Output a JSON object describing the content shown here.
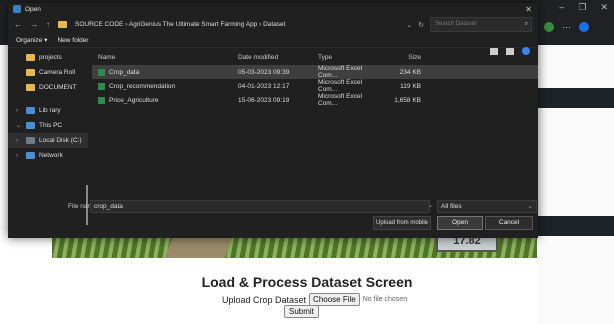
{
  "dialog": {
    "title": "Open",
    "address": "SOURCE CODE  ›  AgriGenius The Ultimate Smart Farming App  ›  Dataset",
    "search_placeholder": "Search Dataset",
    "organize": "Organize ▾",
    "new_folder": "New folder",
    "columns": {
      "name": "Name",
      "date": "Date modified",
      "type": "Type",
      "size": "Size"
    },
    "nav_items": [
      {
        "label": "projects",
        "icon": "folder"
      },
      {
        "label": "Camera Roll",
        "icon": "folder"
      },
      {
        "label": "DOCUMENT",
        "icon": "folder"
      },
      {
        "label": "Lib rary",
        "icon": "library"
      },
      {
        "label": "This PC",
        "icon": "pc"
      },
      {
        "label": "Local Disk (C:)",
        "icon": "drive"
      },
      {
        "label": "Network",
        "icon": "network"
      }
    ],
    "files": [
      {
        "name": "Crop_data",
        "date": "05-03-2023 09:39",
        "type": "Microsoft Excel Com...",
        "size": "234 KB"
      },
      {
        "name": "Crop_recommendation",
        "date": "04-01-2023 12:17",
        "type": "Microsoft Excel Com...",
        "size": "119 KB"
      },
      {
        "name": "Price_Agriculture",
        "date": "15-06-2023 09:19",
        "type": "Microsoft Excel Com...",
        "size": "1,658 KB"
      }
    ],
    "filename_label": "File name:",
    "filename_value": "crop_data",
    "filter": "All files",
    "upload_mobile": "Upload from mobile",
    "open": "Open",
    "cancel": "Cancel"
  },
  "page": {
    "title": "Load & Process Dataset Screen",
    "upload_label": "Upload Crop Dataset",
    "choose_file": "Choose File",
    "no_file": "No file chosen",
    "submit": "Submit",
    "hero_number": "17.82"
  },
  "colors": {
    "dialog_bg": "#202020",
    "folder": "#e8b84a",
    "excel": "#2b8c4c",
    "accent": "#3b82f6"
  }
}
